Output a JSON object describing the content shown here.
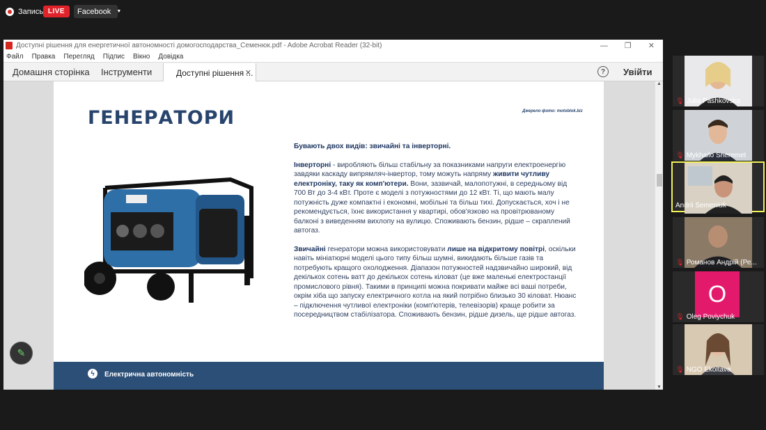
{
  "stream": {
    "recording_label": "Запись",
    "live_label": "LIVE",
    "destination": "Facebook"
  },
  "window": {
    "title": "Доступні рішення для енергетичної автономності  домогосподарства_Семенюк.pdf - Adobe Acrobat Reader (32-bit)",
    "menu": [
      "Файл",
      "Правка",
      "Перегляд",
      "Підпис",
      "Вікно",
      "Довідка"
    ],
    "toolbar": {
      "home": "Домашня сторінка",
      "tools": "Інструменти",
      "doc_tab": "Доступні рішення ...",
      "sign_in": "Увійти"
    }
  },
  "slide": {
    "title": "ГЕНЕРАТОРИ",
    "source": "Джерело фото: motoblok.biz",
    "footer": "Електрична автономність"
  },
  "participants": [
    {
      "name": "Julia Pashkovska",
      "muted": true
    },
    {
      "name": "Mykhailo Sheremet",
      "muted": true
    },
    {
      "name": "Andrii Semeniuk",
      "muted": false,
      "active": true
    },
    {
      "name": "Романов Андрій (Ре...",
      "muted": true
    },
    {
      "name": "Oleg Poviychuk",
      "muted": true,
      "initial": "O"
    },
    {
      "name": "NGO Ekoltava",
      "muted": true
    }
  ]
}
